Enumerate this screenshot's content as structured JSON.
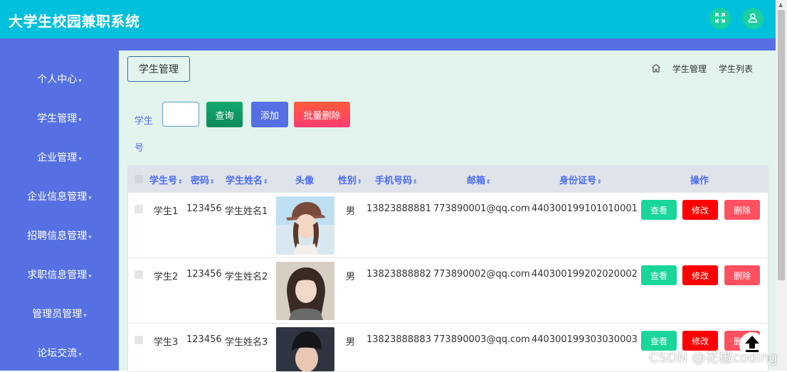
{
  "app": {
    "title": "大学生校园兼职系统"
  },
  "header_icons": {
    "fullscreen": "expand-icon",
    "user": "user-icon",
    "color": "#19d0a0"
  },
  "sidebar": {
    "items": [
      {
        "label": "个人中心"
      },
      {
        "label": "学生管理"
      },
      {
        "label": "企业管理"
      },
      {
        "label": "企业信息管理"
      },
      {
        "label": "招聘信息管理"
      },
      {
        "label": "求职信息管理"
      },
      {
        "label": "管理员管理"
      },
      {
        "label": "论坛交流"
      }
    ],
    "arrow": "▾"
  },
  "page": {
    "title": "学生管理",
    "breadcrumb": {
      "home_icon": "home-icon",
      "items": [
        "学生管理",
        "学生列表"
      ]
    }
  },
  "search": {
    "label": "学生号",
    "value": "",
    "query_label": "查询",
    "add_label": "添加",
    "batch_delete_label": "批量删除"
  },
  "table": {
    "columns": [
      "学生号",
      "密码",
      "学生姓名",
      "头像",
      "性别",
      "手机号码",
      "邮箱",
      "身份证号",
      "操作"
    ],
    "sort_icon": "⇕",
    "rows": [
      {
        "student_no": "学生1",
        "password": "123456",
        "name": "学生姓名1",
        "gender": "男",
        "phone": "13823888881",
        "email": "773890001@qq.com",
        "id_card": "440300199101010001"
      },
      {
        "student_no": "学生2",
        "password": "123456",
        "name": "学生姓名2",
        "gender": "男",
        "phone": "13823888882",
        "email": "773890002@qq.com",
        "id_card": "440300199202020002"
      },
      {
        "student_no": "学生3",
        "password": "123456",
        "name": "学生姓名3",
        "gender": "男",
        "phone": "13823888883",
        "email": "773890003@qq.com",
        "id_card": "440300199303030003"
      }
    ],
    "actions": {
      "view": "查看",
      "edit": "修改",
      "delete": "删除"
    }
  },
  "colors": {
    "header": "#00c0dc",
    "sidebar": "#5470e3",
    "content_bg": "#e3f4ee",
    "query": "#0b9a64",
    "add": "#5470e3",
    "batch_delete": "#ff4050",
    "view": "#19d69a",
    "edit": "#ff0000",
    "delete": "#ff5060"
  },
  "watermark": "CSDN @花椒coding"
}
